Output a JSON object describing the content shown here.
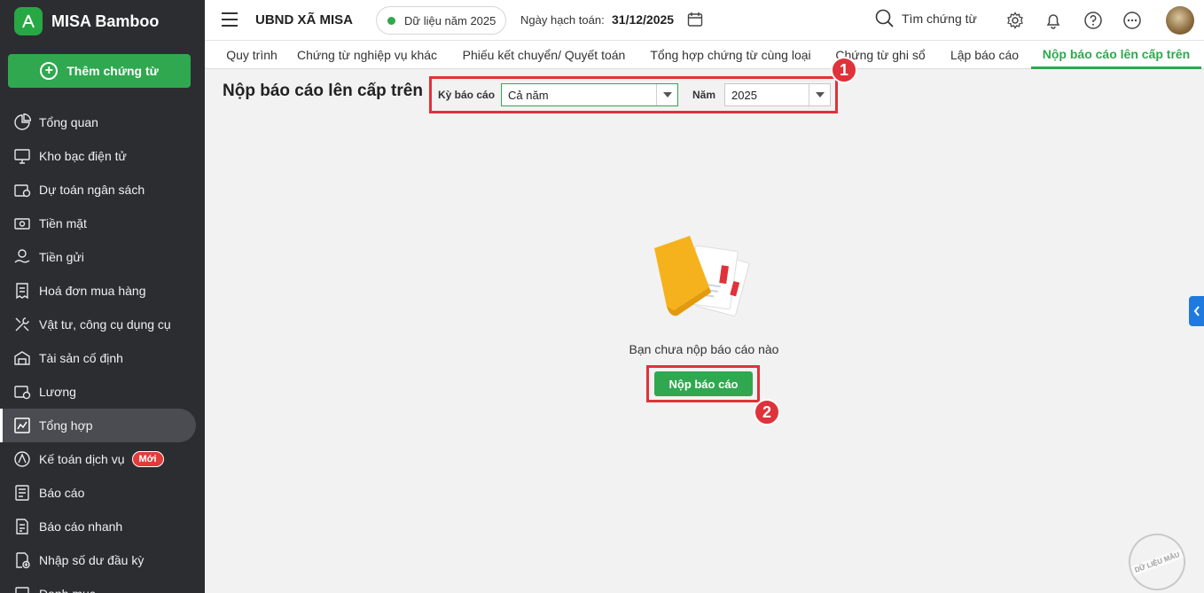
{
  "sidebar": {
    "brand": "MISA Bamboo",
    "add_button": "Thêm chứng từ",
    "items": [
      {
        "label": "Tổng quan",
        "icon": "pie-chart-icon"
      },
      {
        "label": "Kho bạc điện tử",
        "icon": "monitor-icon"
      },
      {
        "label": "Dự toán ngân sách",
        "icon": "budget-icon"
      },
      {
        "label": "Tiền mặt",
        "icon": "cash-icon"
      },
      {
        "label": "Tiền gửi",
        "icon": "deposit-icon"
      },
      {
        "label": "Hoá đơn mua hàng",
        "icon": "invoice-icon"
      },
      {
        "label": "Vật tư, công cụ dụng cụ",
        "icon": "tools-icon"
      },
      {
        "label": "Tài sản cố định",
        "icon": "asset-icon"
      },
      {
        "label": "Lương",
        "icon": "salary-icon"
      },
      {
        "label": "Tổng hợp",
        "icon": "summary-icon"
      },
      {
        "label": "Kế toán dịch vụ",
        "icon": "service-icon",
        "badge": "Mới"
      },
      {
        "label": "Báo cáo",
        "icon": "report-icon"
      },
      {
        "label": "Báo cáo nhanh",
        "icon": "quick-report-icon"
      },
      {
        "label": "Nhập số dư đầu kỳ",
        "icon": "opening-balance-icon"
      },
      {
        "label": "Danh mục",
        "icon": "catalog-icon"
      }
    ],
    "active_index": 9
  },
  "topbar": {
    "org_name": "UBND XÃ MISA",
    "year_data": "Dữ liệu năm 2025",
    "posting_label": "Ngày hạch toán:",
    "posting_date": "31/12/2025",
    "search_label": "Tìm chứng từ"
  },
  "tabs": [
    "Quy trình",
    "Chứng từ nghiệp vụ khác",
    "Phiếu kết chuyển/ Quyết toán",
    "Tổng hợp chứng từ cùng loại",
    "Chứng từ ghi sổ",
    "Lập báo cáo",
    "Nộp báo cáo lên cấp trên"
  ],
  "active_tab": 6,
  "content": {
    "title": "Nộp báo cáo lên cấp trên",
    "period_label": "Kỳ báo cáo",
    "period_value": "Cả năm",
    "year_label": "Năm",
    "year_value": "2025",
    "empty_text": "Bạn chưa nộp báo cáo nào",
    "submit_button": "Nộp báo cáo"
  },
  "markers": [
    "1",
    "2"
  ],
  "watermark": "DỮ LIỆU MẪU",
  "colors": {
    "accent": "#2fa84f",
    "sidebar": "#2b2d31",
    "highlight": "#e0323a"
  }
}
